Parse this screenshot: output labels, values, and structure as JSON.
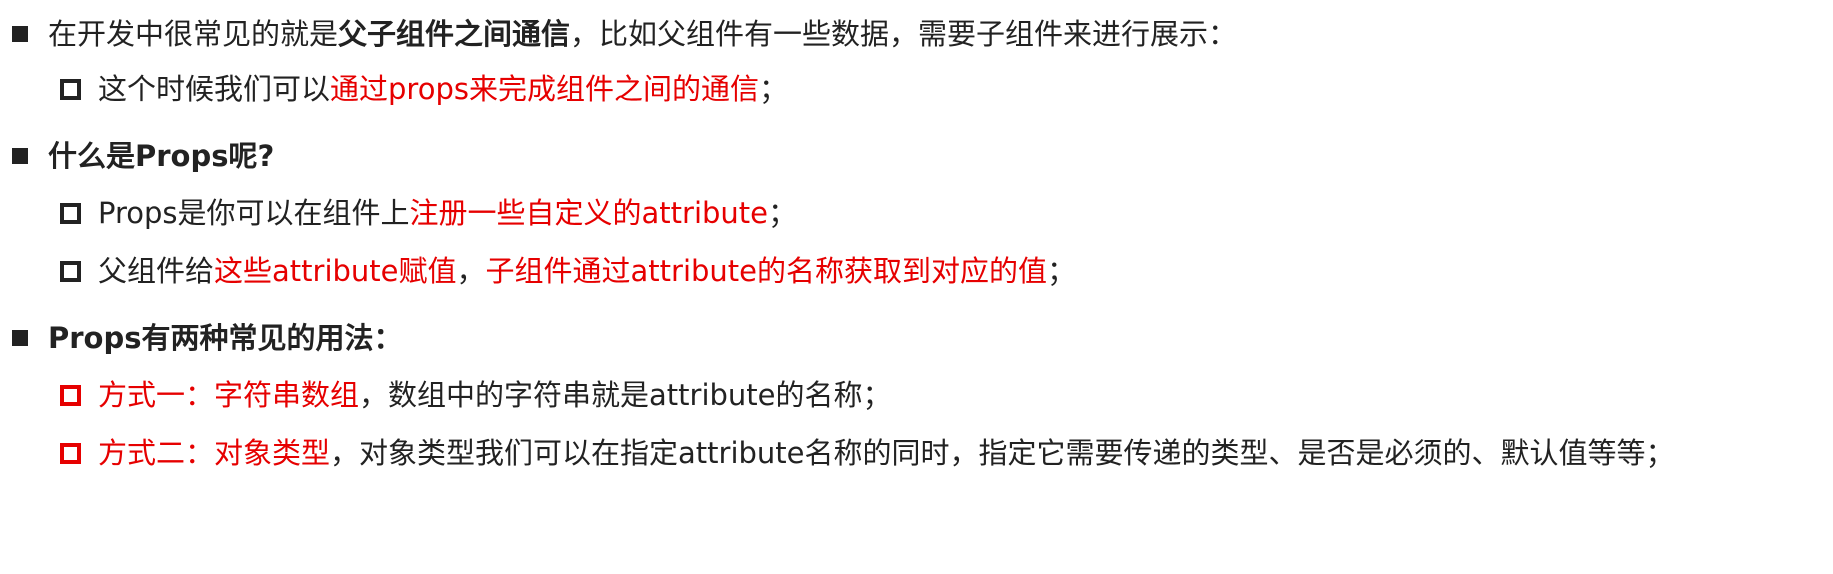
{
  "colors": {
    "text": "#222222",
    "accent": "#e60000"
  },
  "items": [
    {
      "level": 1,
      "bullet": "filled-square",
      "segments": [
        {
          "text": "在开发中很常见的就是",
          "style": "normal"
        },
        {
          "text": "父子组件之间通信",
          "style": "bold"
        },
        {
          "text": "，比如父组件有一些数据，需要子组件来进行展示：",
          "style": "normal"
        }
      ]
    },
    {
      "level": 2,
      "bullet": "hollow-square",
      "segments": [
        {
          "text": "这个时候我们可以",
          "style": "normal"
        },
        {
          "text": "通过props来完成组件之间的通信",
          "style": "red"
        },
        {
          "text": "；",
          "style": "normal"
        }
      ]
    },
    {
      "level": 1,
      "bullet": "filled-square",
      "segments": [
        {
          "text": "什么是Props呢?",
          "style": "bold"
        }
      ]
    },
    {
      "level": 2,
      "bullet": "hollow-square",
      "segments": [
        {
          "text": "Props是你可以在组件上",
          "style": "normal"
        },
        {
          "text": "注册一些自定义的attribute",
          "style": "red"
        },
        {
          "text": "；",
          "style": "normal"
        }
      ]
    },
    {
      "level": 2,
      "bullet": "hollow-square",
      "segments": [
        {
          "text": "父组件给",
          "style": "normal"
        },
        {
          "text": "这些attribute赋值",
          "style": "red"
        },
        {
          "text": "，",
          "style": "normal"
        },
        {
          "text": "子组件通过attribute的名称获取到对应的值",
          "style": "red"
        },
        {
          "text": "；",
          "style": "normal"
        }
      ]
    },
    {
      "level": 1,
      "bullet": "filled-square",
      "segments": [
        {
          "text": "Props有两种常见的用法：",
          "style": "bold"
        }
      ]
    },
    {
      "level": 2,
      "bullet": "hollow-square-red",
      "segments": [
        {
          "text": "方式一：字符串数组",
          "style": "red"
        },
        {
          "text": "，数组中的字符串就是attribute的名称；",
          "style": "normal"
        }
      ]
    },
    {
      "level": 2,
      "bullet": "hollow-square-red",
      "segments": [
        {
          "text": "方式二：对象类型",
          "style": "red"
        },
        {
          "text": "，对象类型我们可以在指定attribute名称的同时，指定它需要传递的类型、是否是必须的、默认值等等；",
          "style": "normal"
        }
      ]
    }
  ]
}
